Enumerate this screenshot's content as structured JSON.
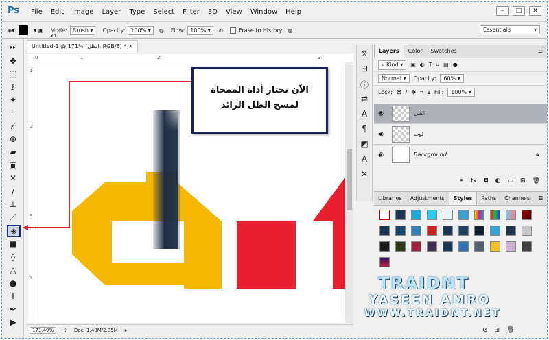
{
  "app": {
    "logo": "Ps"
  },
  "menu": [
    "File",
    "Edit",
    "Image",
    "Layer",
    "Type",
    "Select",
    "Filter",
    "3D",
    "View",
    "Window",
    "Help"
  ],
  "window_controls": [
    "–",
    "□",
    "✕"
  ],
  "options": {
    "brush_size": "34",
    "mode_label": "Mode:",
    "mode_value": "Brush",
    "opacity_label": "Opacity:",
    "opacity_value": "100%",
    "flow_label": "Flow:",
    "flow_value": "100%",
    "erase_history": "Erase to History",
    "workspace": "Essentials"
  },
  "document": {
    "tab_title": "Untitled-1 @ 171% (الظل, RGB/8) *",
    "ruler_ticks": [
      "0",
      "1",
      "2",
      "3"
    ],
    "ruler_v_ticks": [
      "1",
      "2",
      "3",
      "4"
    ],
    "zoom": "171.49%",
    "doc_size": "Doc: 1.40M/2.85M"
  },
  "callout": {
    "line1": "الآن نختار أداة الممحاة",
    "line2": "لمسح الظل الزائد"
  },
  "layers_panel": {
    "tabs": [
      "Layers",
      "Color",
      "Swatches"
    ],
    "filter_kind": "Kind",
    "blend_mode": "Normal",
    "opacity_label": "Opacity:",
    "opacity_value": "60%",
    "lock_label": "Lock:",
    "fill_label": "Fill:",
    "fill_value": "100%",
    "layers": [
      {
        "name": "الظل"
      },
      {
        "name": "لوت"
      },
      {
        "name": "Background"
      }
    ]
  },
  "styles_panel": {
    "tabs": [
      "Libraries",
      "Adjustments",
      "Styles",
      "Paths",
      "Channels"
    ]
  },
  "watermark": {
    "line1": "TRAIDNT",
    "line2": "YASEEN AMRO",
    "line3": "WWW.TRAIDNT.NET"
  },
  "colors": {
    "accent": "#17235e",
    "arrow": "#e0202a",
    "logo_yellow": "#f5b800",
    "logo_red": "#e8202e",
    "shadow_dark": "#1d2c45"
  }
}
